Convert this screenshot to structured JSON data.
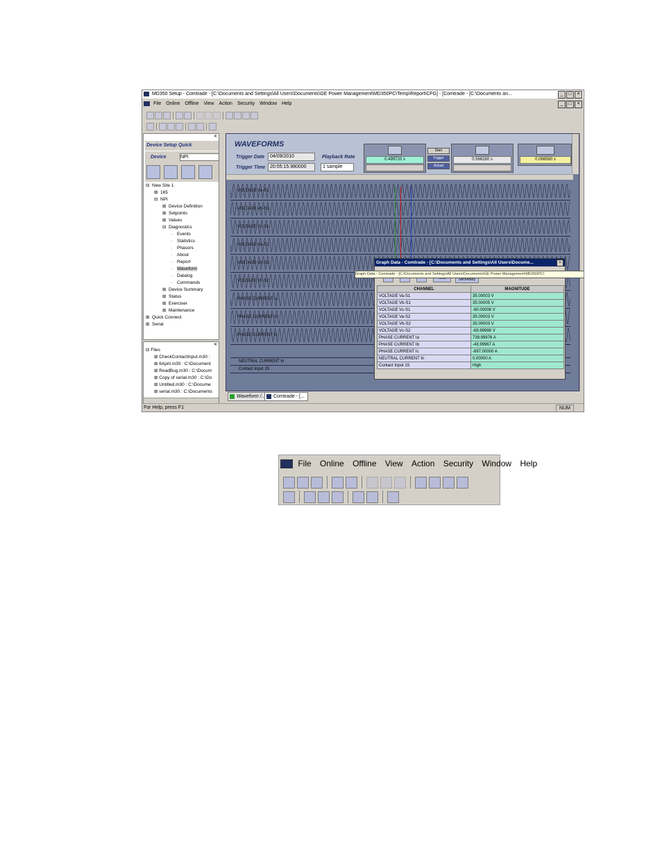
{
  "app": {
    "title": "MD350 Setup  - Comtrade - [C:\\Documents and Settings\\All Users\\Documents\\GE Power Management\\MD350PC\\Temp\\Report\\CFG] - [Comtrade - [C:\\Documents an...",
    "menus": [
      "File",
      "Online",
      "Offline",
      "View",
      "Action",
      "Security",
      "Window",
      "Help"
    ],
    "status_text": "For Help, press F1",
    "status_num": "NUM"
  },
  "left_panel": {
    "tabs": [
      "Device Setup",
      "Quick"
    ],
    "device_label": "Device",
    "device_value": "NPI",
    "tree": [
      {
        "text": "New Site 1",
        "indent": 0,
        "expander": "⊟"
      },
      {
        "text": "165",
        "indent": 1,
        "expander": "⊞"
      },
      {
        "text": "NPI",
        "indent": 1,
        "expander": "⊟"
      },
      {
        "text": "Device Definition",
        "indent": 2,
        "expander": "⊞"
      },
      {
        "text": "Setpoints",
        "indent": 2,
        "expander": "⊞"
      },
      {
        "text": "Values",
        "indent": 2,
        "expander": "⊞"
      },
      {
        "text": "Diagnostics",
        "indent": 2,
        "expander": "⊟"
      },
      {
        "text": "Events",
        "indent": 3,
        "expander": ""
      },
      {
        "text": "Statistics",
        "indent": 3,
        "expander": ""
      },
      {
        "text": "Phasors",
        "indent": 3,
        "expander": ""
      },
      {
        "text": "About",
        "indent": 3,
        "expander": ""
      },
      {
        "text": "Report",
        "indent": 3,
        "expander": ""
      },
      {
        "text": "Waveform",
        "indent": 3,
        "expander": ""
      },
      {
        "text": "Datalog",
        "indent": 3,
        "expander": ""
      },
      {
        "text": "Commands",
        "indent": 3,
        "expander": ""
      },
      {
        "text": "Device Summary",
        "indent": 2,
        "expander": "⊞"
      },
      {
        "text": "Status",
        "indent": 2,
        "expander": "⊞"
      },
      {
        "text": "Exerciser",
        "indent": 2,
        "expander": "⊞"
      },
      {
        "text": "Maintenance",
        "indent": 2,
        "expander": "⊞"
      },
      {
        "text": "Quick Connect",
        "indent": 0,
        "expander": "⊞"
      },
      {
        "text": "Serial",
        "indent": 0,
        "expander": "⊞"
      }
    ],
    "files_title": "Files",
    "files": [
      "CheckContactInput.m30 :",
      "6April.m30 : C:\\Document",
      "ReadBug.m30 : C:\\Docum",
      "Copy of serial.m30 : C:\\Do",
      "Untitled.m30 : C:\\Docume",
      "serial.m30 : C:\\Documents"
    ]
  },
  "waveforms": {
    "heading": "WAVEFORMS",
    "trigger_date_label": "Trigger Date",
    "trigger_date": "04/09/2010",
    "trigger_time_label": "Trigger Time",
    "trigger_time": "20:55:15.980000",
    "playback_label": "Playback Rate",
    "playback_value": "1 sample",
    "cursor1_time": "0.499720 s",
    "cursor2_time": "0.566280 s",
    "delta_time": "0.066560 s",
    "buttons": [
      "Start",
      "Trigger",
      "Actual"
    ],
    "channels": [
      "VOLTAGE Va-S1",
      "VOLTAGE Vb-S1",
      "VOLTAGE Vc-S1",
      "VOLTAGE Va-S2",
      "VOLTAGE Vb-S2",
      "VOLTAGE Vc-S2",
      "PHASE CURRENT Ia",
      "PHASE CURRENT Ib",
      "PHASE CURRENT Ic"
    ],
    "digital_channels": [
      "NEUTRAL CURRENT In",
      "Contact Input 15"
    ],
    "doc_tabs": [
      "Waveform /...",
      "Comtrade - [..."
    ]
  },
  "graph_data": {
    "title": "Graph Data - Comtrade - [C:\\Documents and Settings\\All Users\\Docume...",
    "tooltip": "Graph Data - Comtrade - [C:\\Documents and Settings\\All Users\\Documents\\GE Power Management\\MD350PC\\",
    "buttons": [
      "RMS",
      "Secondary"
    ],
    "col_channel": "CHANNEL",
    "col_magnitude": "MAGNITUDE",
    "rows": [
      {
        "channel": "VOLTAGE Va-S1",
        "magnitude": "35.00003 V"
      },
      {
        "channel": "VOLTAGE Vb-S1",
        "magnitude": "35.00005 V"
      },
      {
        "channel": "VOLTAGE Vc-S1",
        "magnitude": "-60.00008 V"
      },
      {
        "channel": "VOLTAGE Va-S2",
        "magnitude": "35.00003 V"
      },
      {
        "channel": "VOLTAGE Vb-S2",
        "magnitude": "35.00003 V"
      },
      {
        "channel": "VOLTAGE Vc-S2",
        "magnitude": "-69.99998 V"
      },
      {
        "channel": "PHASE CURRENT Ia",
        "magnitude": "739.99976 A"
      },
      {
        "channel": "PHASE CURRENT Ib",
        "magnitude": "-43.99967 A"
      },
      {
        "channel": "PHASE CURRENT Ic",
        "magnitude": "-897.00000 A"
      },
      {
        "channel": "NEUTRAL CURRENT In",
        "magnitude": "0.00000 A"
      },
      {
        "channel": "Contact Input 15",
        "magnitude": "High"
      }
    ]
  },
  "zoom_menubar": {
    "menus": [
      "File",
      "Online",
      "Offline",
      "View",
      "Action",
      "Security",
      "Window",
      "Help"
    ]
  }
}
